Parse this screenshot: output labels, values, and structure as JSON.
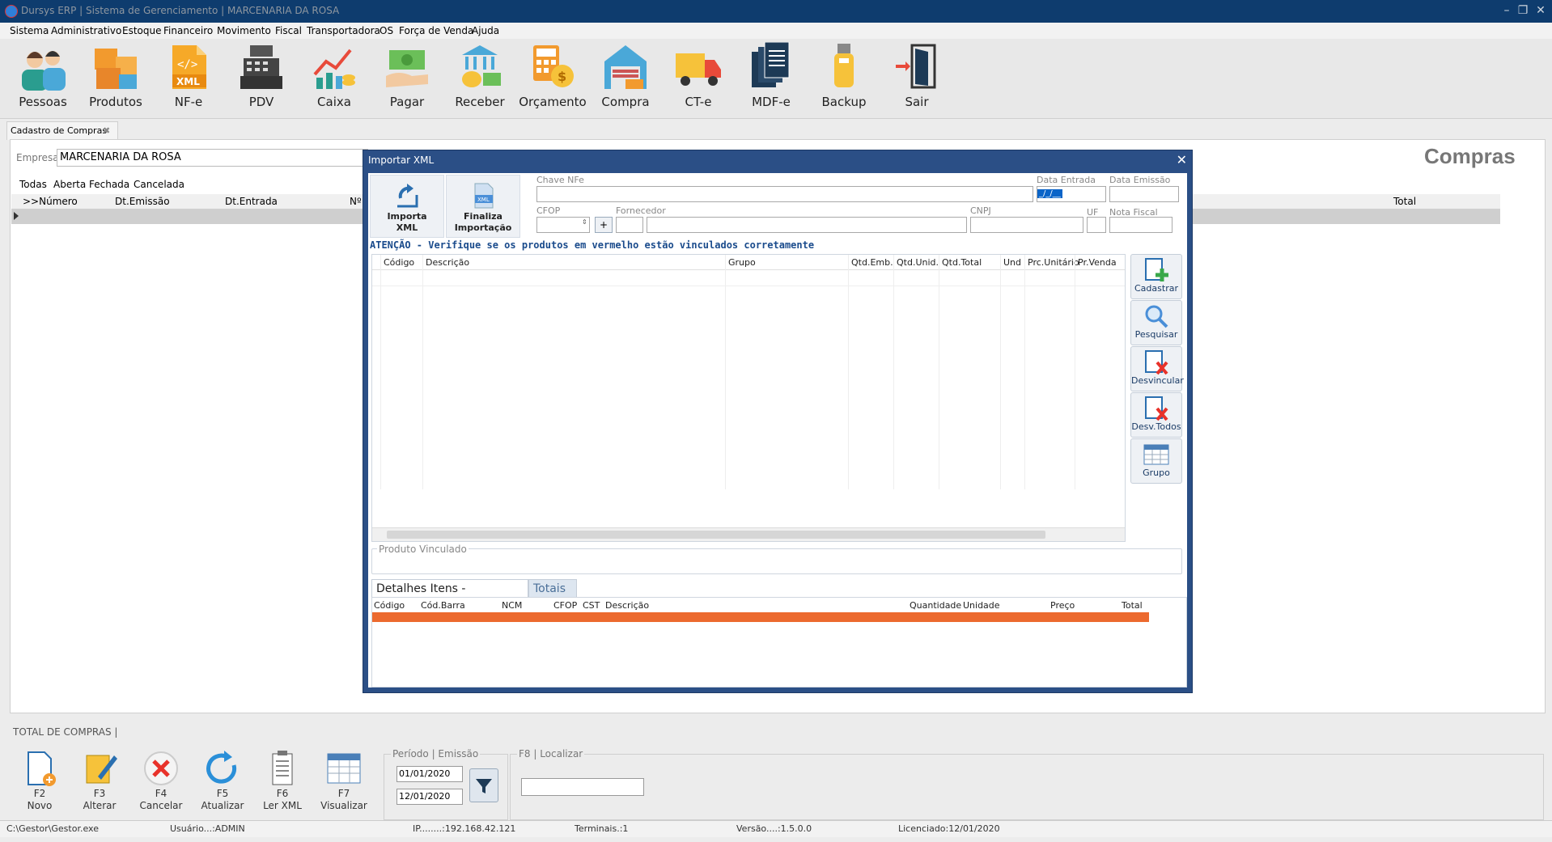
{
  "window": {
    "title": "Dursys ERP | Sistema de Gerenciamento | MARCENARIA DA ROSA",
    "controls": [
      "–",
      "❐",
      "✕"
    ]
  },
  "menu": [
    "Sistema",
    "Administrativo",
    "Estoque",
    "Financeiro",
    "Movimento",
    "Fiscal",
    "Transportadora",
    "OS",
    "Força de Venda",
    "Ajuda"
  ],
  "toolbar": [
    {
      "label": "Pessoas",
      "icon": "people-icon"
    },
    {
      "label": "Produtos",
      "icon": "boxes-icon"
    },
    {
      "label": "NF-e",
      "icon": "xml-file-icon"
    },
    {
      "label": "PDV",
      "icon": "cash-register-icon"
    },
    {
      "label": "Caixa",
      "icon": "chart-coins-icon"
    },
    {
      "label": "Pagar",
      "icon": "pay-money-icon"
    },
    {
      "label": "Receber",
      "icon": "receive-money-icon"
    },
    {
      "label": "Orçamento",
      "icon": "calculator-icon"
    },
    {
      "label": "Compra",
      "icon": "warehouse-icon"
    },
    {
      "label": "CT-e",
      "icon": "truck-icon"
    },
    {
      "label": "MDF-e",
      "icon": "documents-icon"
    },
    {
      "label": "Backup",
      "icon": "usb-drive-icon"
    },
    {
      "label": "Sair",
      "icon": "exit-door-icon"
    }
  ],
  "doc_tab": {
    "label": "Cadastro de Compras"
  },
  "main": {
    "empresa_label": "Empresa:",
    "empresa_value": "MARCENARIA DA ROSA",
    "page_title": "Compras",
    "filter_tabs": [
      "Todas",
      "Aberta",
      "Fechada",
      "Cancelada"
    ],
    "columns": [
      ">>Número",
      "Dt.Emissão",
      "Dt.Entrada",
      "Nº",
      "Total"
    ]
  },
  "total_label": "TOTAL DE COMPRAS |",
  "bottom_buttons": [
    {
      "key": "F2",
      "label": "Novo",
      "icon": "new-document-icon"
    },
    {
      "key": "F3",
      "label": "Alterar",
      "icon": "edit-icon"
    },
    {
      "key": "F4",
      "label": "Cancelar",
      "icon": "cancel-icon"
    },
    {
      "key": "F5",
      "label": "Atualizar",
      "icon": "refresh-icon"
    },
    {
      "key": "F6",
      "label": "Ler XML",
      "icon": "read-xml-icon"
    },
    {
      "key": "F7",
      "label": "Visualizar",
      "icon": "view-table-icon"
    }
  ],
  "periodo": {
    "caption": "Período | Emissão",
    "start": "01/01/2020",
    "end": "12/01/2020"
  },
  "localizar": {
    "caption": "F8 | Localizar",
    "value": ""
  },
  "status": {
    "path": "C:\\Gestor\\Gestor.exe",
    "user": "Usuário...:ADMIN",
    "ip": "IP........:192.168.42.121",
    "terminais": "Terminais.:1",
    "versao": "Versão....:1.5.0.0",
    "licenciado": "Licenciado:12/01/2020"
  },
  "dialog": {
    "title": "Importar XML",
    "close": "✕",
    "buttons": [
      {
        "line1": "Importa",
        "line2": "XML",
        "icon": "import-xml-icon"
      },
      {
        "line1": "Finaliza",
        "line2": "Importação",
        "icon": "finalize-xml-icon"
      }
    ],
    "fields": {
      "chave_nfe": {
        "label": "Chave NFe",
        "value": ""
      },
      "data_entrada": {
        "label": "Data Entrada",
        "value": "_/_/__"
      },
      "data_emissao": {
        "label": "Data Emissão",
        "value": ""
      },
      "cfop": {
        "label": "CFOP",
        "value": ""
      },
      "fornecedor": {
        "label": "Fornecedor",
        "value": ""
      },
      "cnpj": {
        "label": "CNPJ",
        "value": ""
      },
      "uf": {
        "label": "UF",
        "value": ""
      },
      "nota_fiscal": {
        "label": "Nota Fiscal",
        "value": ""
      }
    },
    "plus_label": "+",
    "warning": "ATENÇÃO - Verifique se os produtos em vermelho estão vinculados corretamente",
    "item_columns": [
      "Código",
      "Descrição",
      "Grupo",
      "Qtd.Emb.",
      "Qtd.Unid.",
      "Qtd.Total",
      "Und",
      "Prc.Unitário",
      "Pr.Venda"
    ],
    "side_buttons": [
      {
        "label": "Cadastrar",
        "icon": "add-product-icon"
      },
      {
        "label": "Pesquisar",
        "icon": "search-icon"
      },
      {
        "label": "Desvincular",
        "icon": "unlink-icon"
      },
      {
        "label": "Desv.Todos",
        "icon": "unlink-all-icon"
      },
      {
        "label": "Grupo",
        "icon": "group-table-icon"
      }
    ],
    "produto_vinculado": "Produto Vinculado",
    "bottom_tabs": [
      "Detalhes Itens - Fornecedor",
      "Totais"
    ],
    "detail_columns": [
      "Código",
      "Cód.Barra",
      "NCM",
      "CFOP",
      "CST",
      "Descrição",
      "Quantidade",
      "Unidade",
      "Preço",
      "Total"
    ]
  },
  "colors": {
    "titlebar": "#0e3c6e",
    "dialog_frame": "#2b4f86",
    "warning_text": "#1a4b8c",
    "orange_row": "#ec6a2f"
  }
}
